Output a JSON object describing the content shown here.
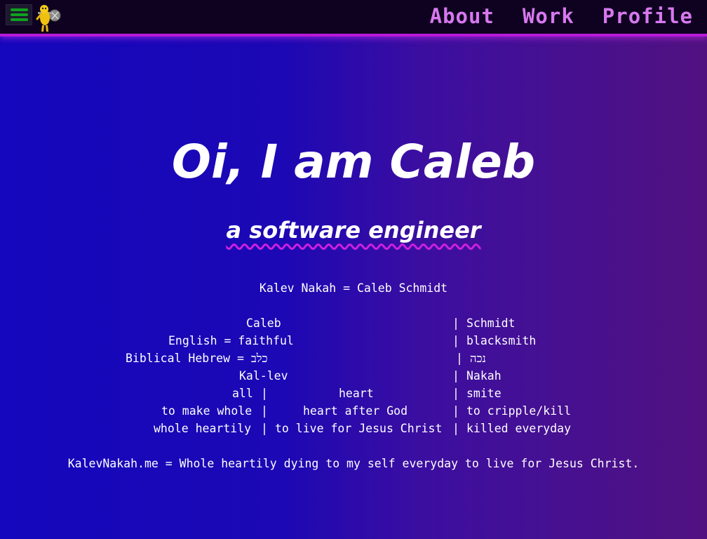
{
  "nav": {
    "menu_icon": "hamburger-icon",
    "logo_icon": "yellow-character-logo-icon",
    "links": [
      {
        "label": "About"
      },
      {
        "label": "Work"
      },
      {
        "label": "Profile"
      }
    ]
  },
  "hero": {
    "title": "Oi, I am Caleb",
    "subtitle": "a software engineer"
  },
  "meaning": {
    "intro": "Kalev Nakah = Caleb Schmidt",
    "rows": [
      {
        "left": "Caleb",
        "right": "Schmidt"
      },
      {
        "left": "English = faithful",
        "right": "blacksmith"
      },
      {
        "left": "Biblical Hebrew = כלב",
        "right": "נכה"
      },
      {
        "left": "Kal-lev",
        "right": "Nakah"
      },
      {
        "left": "all",
        "mid": "heart",
        "right": "smite"
      },
      {
        "left": "to make whole",
        "mid": "heart after God",
        "right": "to cripple/kill"
      },
      {
        "left": "whole heartily",
        "mid": "to live for Jesus Christ",
        "right": "killed everyday"
      }
    ],
    "separator": "|",
    "conclusion": "KalevNakah.me = Whole heartily dying to my self everyday to live for Jesus Christ."
  },
  "colors": {
    "nav_bg": "#0e0220",
    "nav_border": "#b81ad8",
    "nav_link": "#d778ee",
    "menu_bars": "#11a020",
    "wavy_underline": "#cc20e0",
    "bg_left": "#1407bd",
    "bg_right": "#511280"
  }
}
